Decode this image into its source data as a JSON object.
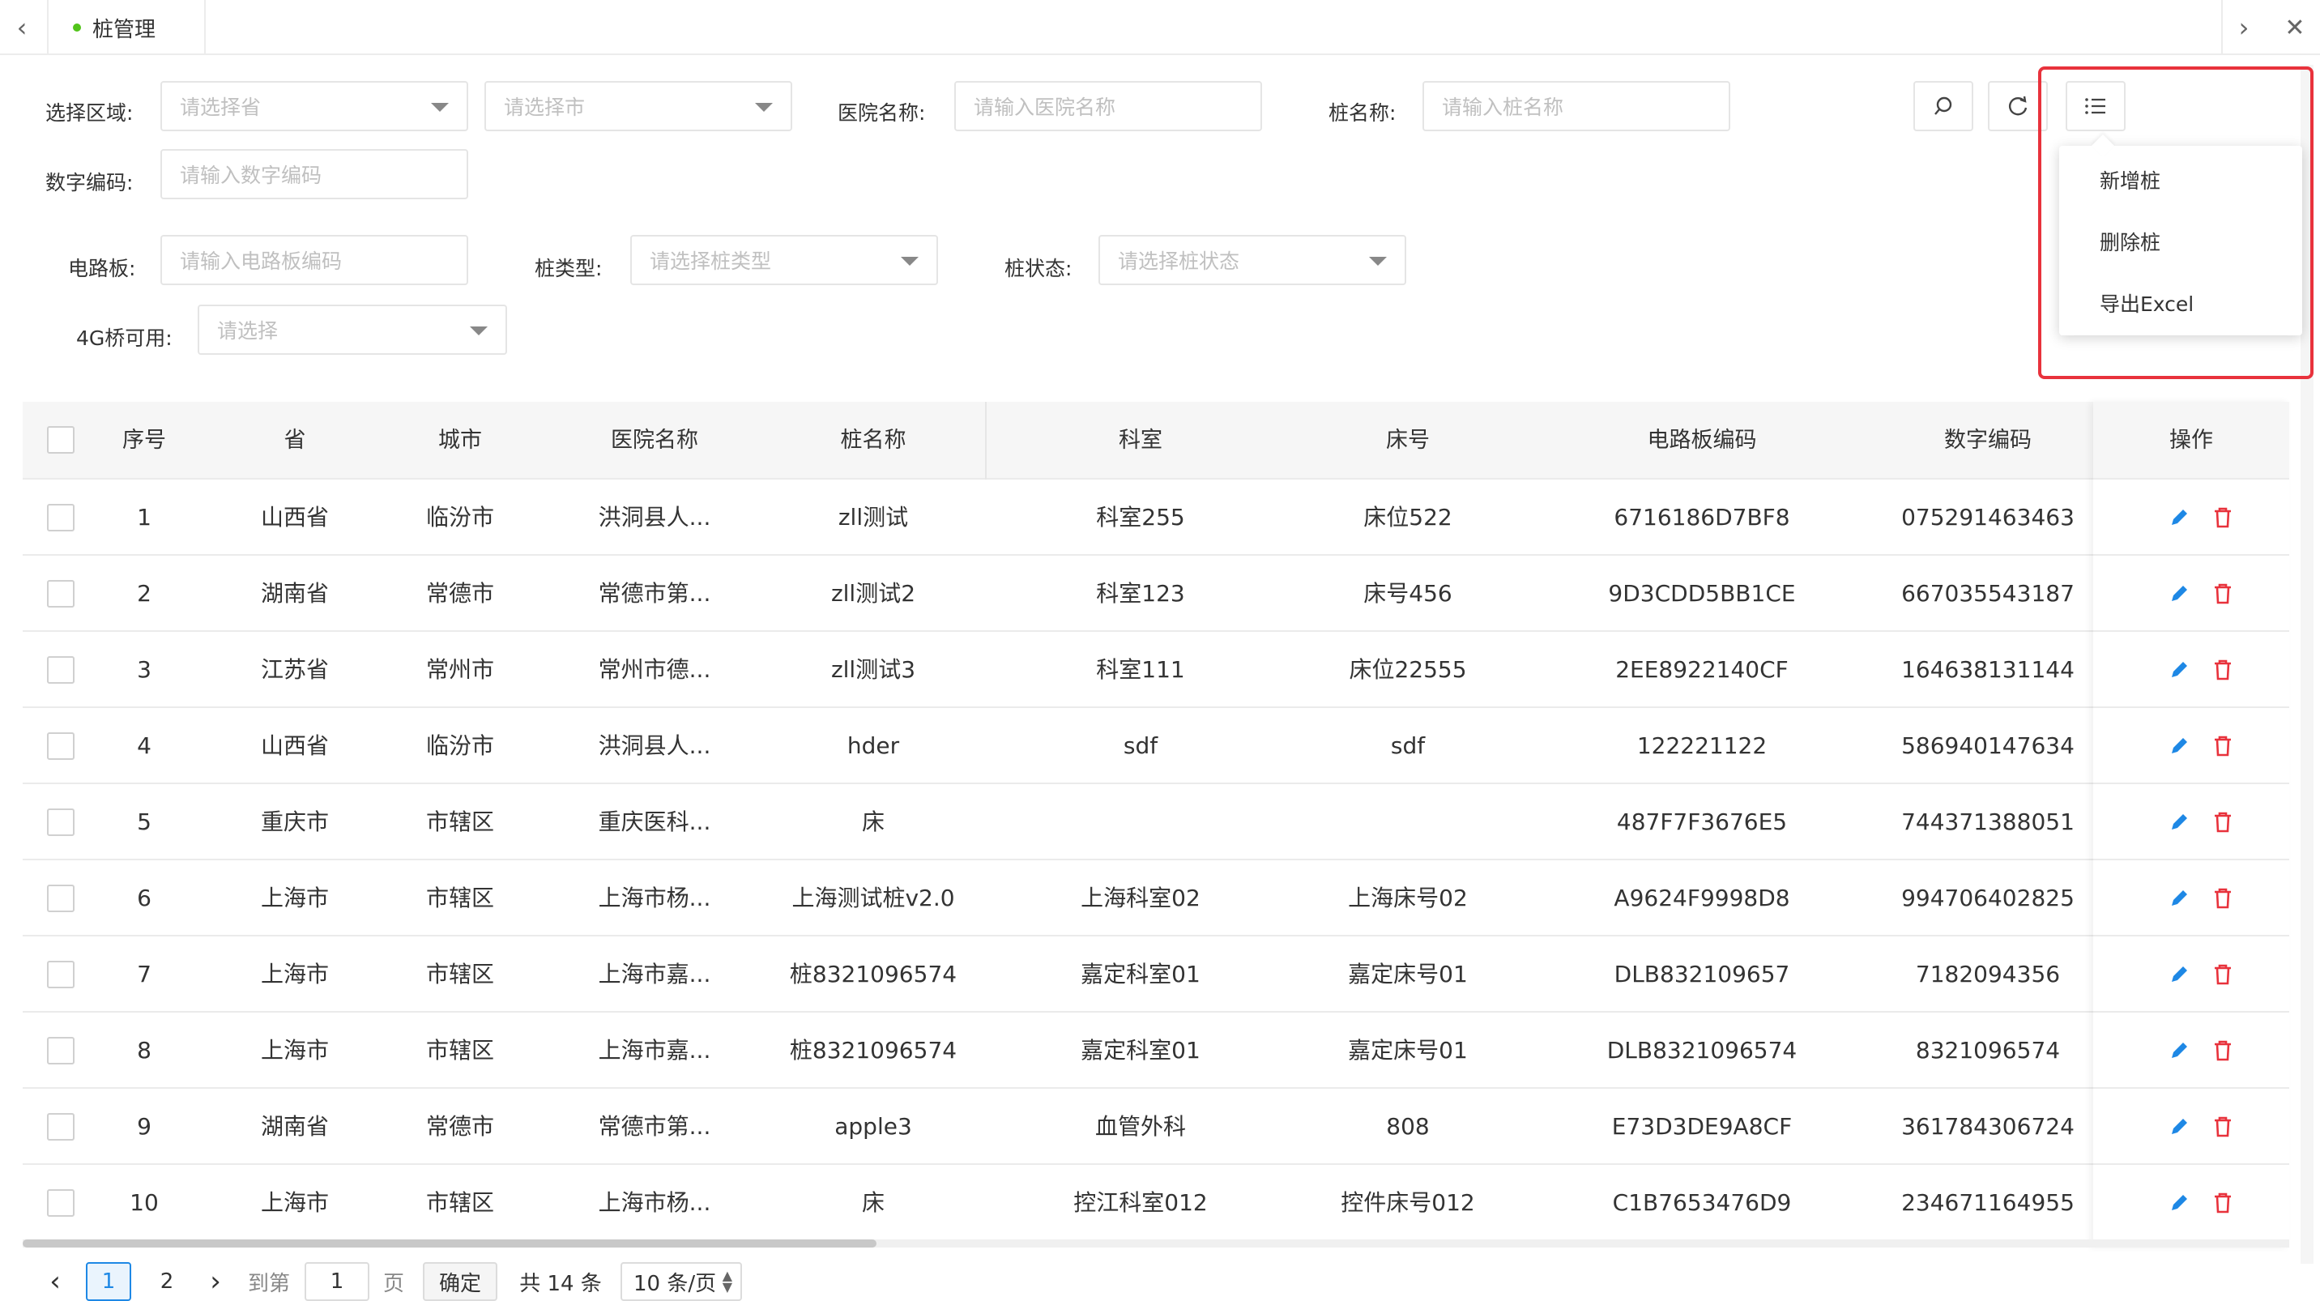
{
  "tab": {
    "label": "桩管理"
  },
  "filters": {
    "region_label": "选择区域:",
    "province_placeholder": "请选择省",
    "city_placeholder": "请选择市",
    "hospital_label": "医院名称:",
    "hospital_placeholder": "请输入医院名称",
    "pile_name_label": "桩名称:",
    "pile_name_placeholder": "请输入桩名称",
    "digital_code_label": "数字编码:",
    "digital_code_placeholder": "请输入数字编码",
    "circuit_label": "电路板:",
    "circuit_placeholder": "请输入电路板编码",
    "pile_type_label": "桩类型:",
    "pile_type_placeholder": "请选择桩类型",
    "pile_status_label": "桩状态:",
    "pile_status_placeholder": "请选择桩状态",
    "bridge_label": "4G桥可用:",
    "bridge_placeholder": "请选择"
  },
  "menu": {
    "items": [
      "新增桩",
      "删除桩",
      "导出Excel"
    ]
  },
  "table": {
    "columns": [
      "序号",
      "省",
      "城市",
      "医院名称",
      "桩名称",
      "科室",
      "床号",
      "电路板编码",
      "数字编码",
      "操作"
    ],
    "rows": [
      [
        "1",
        "山西省",
        "临汾市",
        "洪洞县人...",
        "zll测试",
        "科室255",
        "床位522",
        "6716186D7BF8",
        "075291463463"
      ],
      [
        "2",
        "湖南省",
        "常德市",
        "常德市第...",
        "zll测试2",
        "科室123",
        "床号456",
        "9D3CDD5BB1CE",
        "667035543187"
      ],
      [
        "3",
        "江苏省",
        "常州市",
        "常州市德...",
        "zll测试3",
        "科室111",
        "床位22555",
        "2EE8922140CF",
        "164638131144"
      ],
      [
        "4",
        "山西省",
        "临汾市",
        "洪洞县人...",
        "hder",
        "sdf",
        "sdf",
        "122221122",
        "586940147634"
      ],
      [
        "5",
        "重庆市",
        "市辖区",
        "重庆医科...",
        "床",
        "",
        "",
        "487F7F3676E5",
        "744371388051"
      ],
      [
        "6",
        "上海市",
        "市辖区",
        "上海市杨...",
        "上海测试桩v2.0",
        "上海科室02",
        "上海床号02",
        "A9624F9998D8",
        "994706402825"
      ],
      [
        "7",
        "上海市",
        "市辖区",
        "上海市嘉...",
        "桩8321096574",
        "嘉定科室01",
        "嘉定床号01",
        "DLB832109657",
        "7182094356"
      ],
      [
        "8",
        "上海市",
        "市辖区",
        "上海市嘉...",
        "桩8321096574",
        "嘉定科室01",
        "嘉定床号01",
        "DLB8321096574",
        "8321096574"
      ],
      [
        "9",
        "湖南省",
        "常德市",
        "常德市第...",
        "apple3",
        "血管外科",
        "808",
        "E73D3DE9A8CF",
        "361784306724"
      ],
      [
        "10",
        "上海市",
        "市辖区",
        "上海市杨...",
        "床",
        "控江科室012",
        "控件床号012",
        "C1B7653476D9",
        "234671164955"
      ]
    ]
  },
  "pagination": {
    "current_page": "1",
    "page2": "2",
    "goto_label": "到第",
    "goto_value": "1",
    "page_unit": "页",
    "confirm_label": "确定",
    "total_label": "共 14 条",
    "page_size": "10 条/页"
  },
  "colors": {
    "accent": "#1e88e5",
    "delete": "#e8323c",
    "highlight_box": "#e8323c"
  }
}
